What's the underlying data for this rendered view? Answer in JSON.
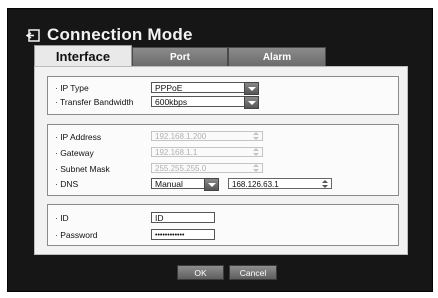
{
  "window": {
    "title": "Connection Mode"
  },
  "tabs": [
    {
      "label": "Interface",
      "active": true
    },
    {
      "label": "Port",
      "active": false
    },
    {
      "label": "Alarm",
      "active": false
    }
  ],
  "group1": {
    "ip_type": {
      "label": "· IP Type",
      "value": "PPPoE"
    },
    "transfer_bandwidth": {
      "label": "· Transfer Bandwidth",
      "value": "600kbps"
    }
  },
  "group2": {
    "ip_address": {
      "label": "· IP Address",
      "value": "192.168.1.200"
    },
    "gateway": {
      "label": "· Gateway",
      "value": "192.168.1.1"
    },
    "subnet_mask": {
      "label": "· Subnet Mask",
      "value": "255.255.255.0"
    },
    "dns": {
      "label": "· DNS",
      "mode": "Manual",
      "value": "168.126.63.1"
    }
  },
  "group3": {
    "id": {
      "label": "· ID",
      "value": "ID"
    },
    "password": {
      "label": "· Password",
      "value": "••••••••••••"
    }
  },
  "buttons": {
    "ok": "OK",
    "cancel": "Cancel"
  },
  "colors": {
    "background": "#161616",
    "panel": "#f2f2f2",
    "active_tab": "#e9e9e9",
    "button": "#6e6e6e"
  },
  "icons": {
    "title": "exit-arrow-icon"
  }
}
